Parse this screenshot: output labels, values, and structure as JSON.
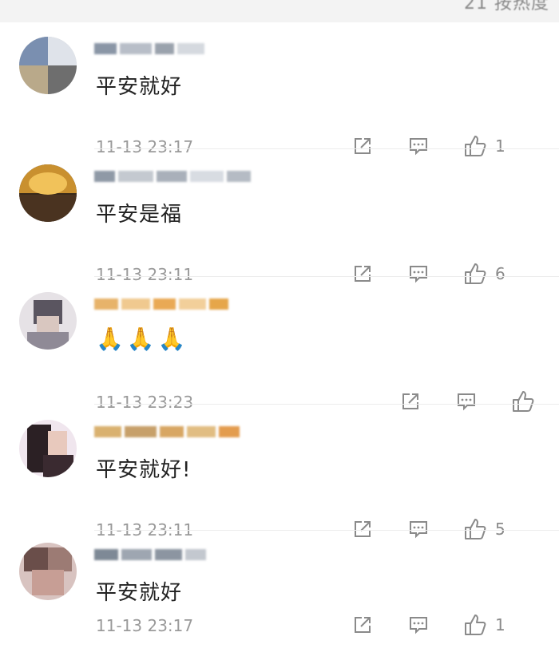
{
  "header": {
    "sort_label": "21 按热度"
  },
  "comments": [
    {
      "text": "平安就好",
      "time": "11-13 23:17",
      "likes": "1"
    },
    {
      "text": "平安是福",
      "time": "11-13 23:11",
      "likes": "6"
    },
    {
      "text": "🙏🙏🙏",
      "time": "11-13 23:23",
      "likes": ""
    },
    {
      "text": "平安就好!",
      "time": "11-13 23:11",
      "likes": "5"
    },
    {
      "text": "平安就好",
      "time": "11-13 23:17",
      "likes": "1"
    }
  ],
  "icons": {
    "share": "share-icon",
    "reply": "reply-icon",
    "like": "thumbs-up-icon"
  },
  "colors": {
    "text": "#222222",
    "meta": "#9a9a9a",
    "icon": "#8a8a8a",
    "divider": "#ececec"
  }
}
